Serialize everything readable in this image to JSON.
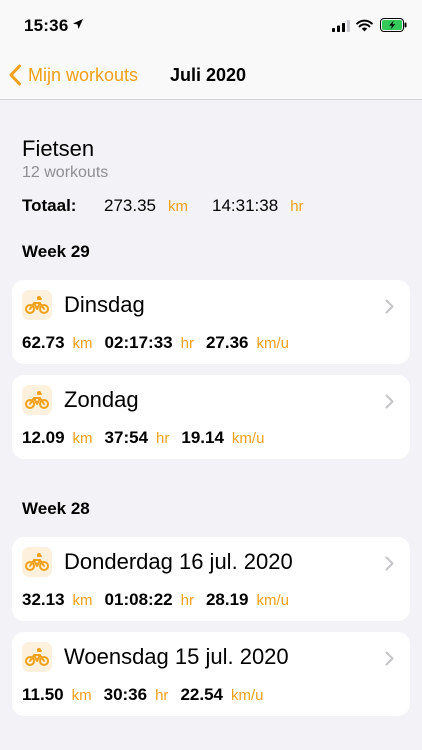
{
  "status": {
    "time": "15:36"
  },
  "nav": {
    "back_label": "Mijn workouts",
    "title": "Juli 2020"
  },
  "summary": {
    "sport": "Fietsen",
    "count": "12 workouts",
    "total_label": "Totaal:",
    "distance": "273.35",
    "distance_unit": "km",
    "duration": "14:31:38",
    "duration_unit": "hr"
  },
  "weeks": [
    {
      "label": "Week 29"
    },
    {
      "label": "Week 28"
    }
  ],
  "workouts": [
    {
      "title": "Dinsdag",
      "distance": "62.73",
      "distance_unit": "km",
      "duration": "02:17:33",
      "duration_unit": "hr",
      "speed": "27.36",
      "speed_unit": "km/u"
    },
    {
      "title": "Zondag",
      "distance": "12.09",
      "distance_unit": "km",
      "duration": "37:54",
      "duration_unit": "hr",
      "speed": "19.14",
      "speed_unit": "km/u"
    },
    {
      "title": "Donderdag 16 jul. 2020",
      "distance": "32.13",
      "distance_unit": "km",
      "duration": "01:08:22",
      "duration_unit": "hr",
      "speed": "28.19",
      "speed_unit": "km/u"
    },
    {
      "title": "Woensdag 15 jul. 2020",
      "distance": "11.50",
      "distance_unit": "km",
      "duration": "30:36",
      "duration_unit": "hr",
      "speed": "22.54",
      "speed_unit": "km/u"
    }
  ],
  "colors": {
    "accent": "#f0a019",
    "background": "#f2f2f7",
    "card": "#ffffff",
    "secondary_text": "#8e8e93",
    "battery": "#34c759"
  },
  "icons": {
    "workout": "bicycle-icon",
    "back": "chevron-left-icon",
    "row": "chevron-right-icon"
  }
}
